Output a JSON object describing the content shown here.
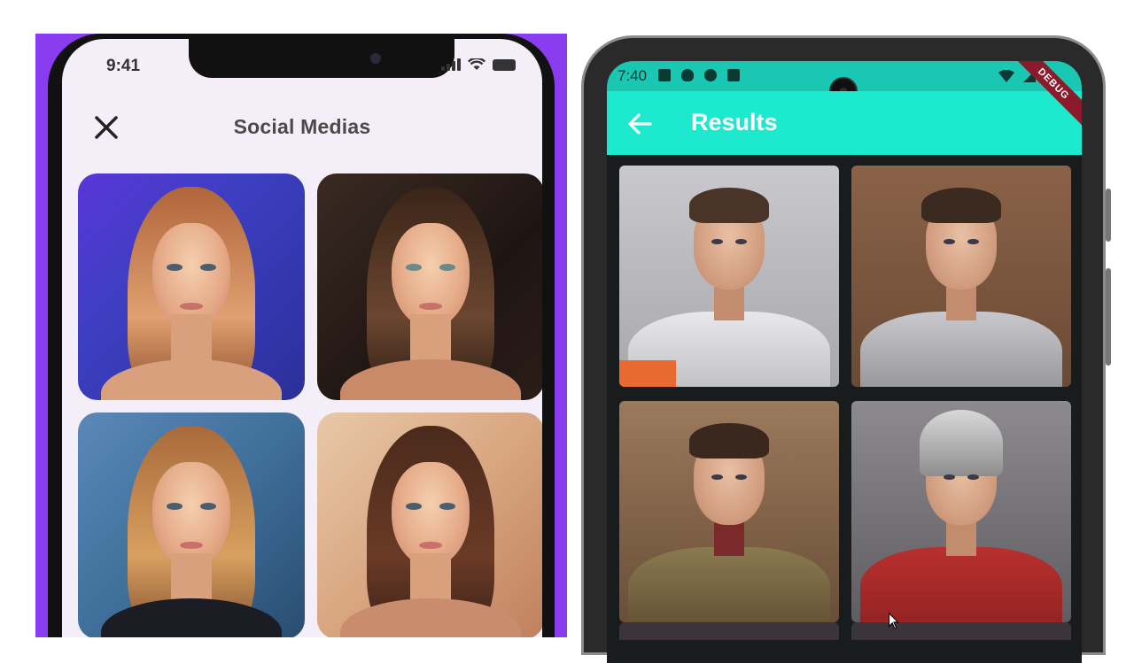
{
  "left_phone": {
    "status_time": "9:41",
    "title": "Social Medias",
    "close_icon": "close-icon",
    "portraits": [
      {
        "name": "portrait-woman-1",
        "bg": "#4a3ad0"
      },
      {
        "name": "portrait-woman-2",
        "bg": "#2a1d18"
      },
      {
        "name": "portrait-woman-3",
        "bg": "#4f7faf"
      },
      {
        "name": "portrait-woman-4",
        "bg": "#dcae88"
      }
    ]
  },
  "right_phone": {
    "status_time": "7:40",
    "app_bar_title": "Results",
    "debug_banner": "DEBUG",
    "accent_color": "#1de9cf",
    "results": [
      {
        "name": "result-astronaut"
      },
      {
        "name": "result-armor-1"
      },
      {
        "name": "result-armor-2"
      },
      {
        "name": "result-knight-helmet"
      }
    ]
  }
}
